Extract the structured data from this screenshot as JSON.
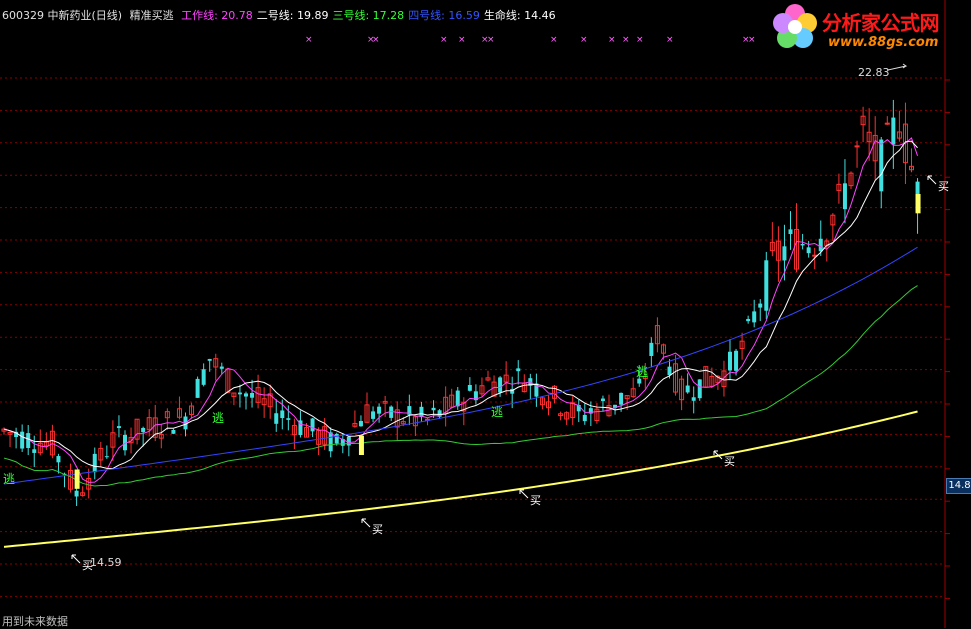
{
  "header": {
    "code_name": "600329 中新药业(日线)",
    "indicator": "精准买逃",
    "lines": [
      {
        "label": "工作线:",
        "value": "20.78",
        "color": "#ff44ff"
      },
      {
        "label": "二号线:",
        "value": "19.89",
        "color": "#ffffff"
      },
      {
        "label": "三号线:",
        "value": "17.28",
        "color": "#33ff33"
      },
      {
        "label": "四号线:",
        "value": "16.59",
        "color": "#3355ff"
      },
      {
        "label": "生命线:",
        "value": "14.46",
        "color": "#ffffff"
      }
    ]
  },
  "logo": {
    "title": "分析家公式网",
    "url": "www.88gs.com"
  },
  "footer": {
    "text": "用到未来数据"
  },
  "price_tag": "14.8",
  "labels": {
    "high_price": "22.83",
    "low_price": "14.59",
    "buy": "买",
    "escape": "逃"
  },
  "chart_data": {
    "type": "candlestick",
    "markers": [
      {
        "type": "逃",
        "x": 0.01
      },
      {
        "type": "逃",
        "x": 0.22
      },
      {
        "type": "逃",
        "x": 0.51
      },
      {
        "type": "逃",
        "x": 0.66
      },
      {
        "type": "买",
        "x": 0.08
      },
      {
        "type": "买",
        "x": 0.37
      },
      {
        "type": "买",
        "x": 0.54
      },
      {
        "type": "买",
        "x": 0.74
      },
      {
        "type": "买",
        "x": 0.96
      }
    ],
    "high": 22.83,
    "low": 14.59,
    "colors": {
      "up": "#ff3030",
      "down": "#40e0e0",
      "grid": "#8b0000",
      "yellow": "#ffff66"
    }
  }
}
